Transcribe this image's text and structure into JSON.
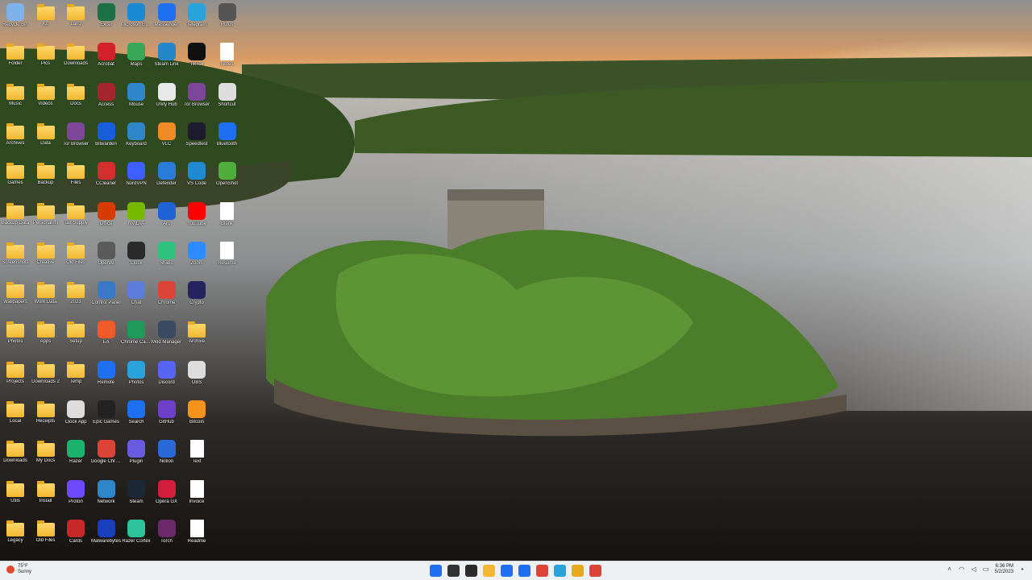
{
  "desktop": {
    "wallpaper": "lake-castle-island",
    "icons": [
      {
        "label": "Recycle Bin",
        "kind": "app",
        "icon": "recycle-bin-icon",
        "color": "#7fb2e8"
      },
      {
        "label": "Kit",
        "kind": "folder",
        "icon": "folder-icon",
        "color": "#f2b731"
      },
      {
        "label": "Lang",
        "kind": "folder",
        "icon": "folder-icon",
        "color": "#f2b731"
      },
      {
        "label": "Excel",
        "kind": "app",
        "icon": "excel-icon",
        "color": "#1d7044"
      },
      {
        "label": "Microsoft Edge",
        "kind": "app",
        "icon": "edge-icon",
        "color": "#1a8ad4"
      },
      {
        "label": "Messenger",
        "kind": "app",
        "icon": "messenger-icon",
        "color": "#1e6ff2"
      },
      {
        "label": "Telegram",
        "kind": "app",
        "icon": "telegram-icon",
        "color": "#2aa3dd"
      },
      {
        "label": "Rufus",
        "kind": "app",
        "icon": "usb-icon",
        "color": "#555555"
      },
      {
        "label": "Folder",
        "kind": "folder",
        "icon": "folder-icon",
        "color": "#f2b731"
      },
      {
        "label": "Pics",
        "kind": "folder",
        "icon": "folder-icon",
        "color": "#f2b731"
      },
      {
        "label": "Downloads",
        "kind": "folder",
        "icon": "folder-icon",
        "color": "#f2b731"
      },
      {
        "label": "Acrobat",
        "kind": "app",
        "icon": "pdf-icon",
        "color": "#d3202a"
      },
      {
        "label": "Maps",
        "kind": "app",
        "icon": "maps-icon",
        "color": "#3aa657"
      },
      {
        "label": "Steam Link",
        "kind": "app",
        "icon": "steam-link-icon",
        "color": "#2487c9"
      },
      {
        "label": "TikTok",
        "kind": "app",
        "icon": "tiktok-icon",
        "color": "#111111"
      },
      {
        "label": "Notes",
        "kind": "doc",
        "icon": "document-icon",
        "color": "#ffffff"
      },
      {
        "label": "Music",
        "kind": "folder",
        "icon": "folder-icon",
        "color": "#f2b731"
      },
      {
        "label": "Videos",
        "kind": "folder",
        "icon": "folder-icon",
        "color": "#f2b731"
      },
      {
        "label": "Docs",
        "kind": "folder",
        "icon": "folder-icon",
        "color": "#f2b731"
      },
      {
        "label": "Access",
        "kind": "app",
        "icon": "access-icon",
        "color": "#a4262c"
      },
      {
        "label": "Mouse",
        "kind": "app",
        "icon": "mouse-icon",
        "color": "#2f86c8"
      },
      {
        "label": "Unity Hub",
        "kind": "app",
        "icon": "unity-icon",
        "color": "#e8e8e8"
      },
      {
        "label": "Tor Browser",
        "kind": "app",
        "icon": "tor-icon",
        "color": "#7d4698"
      },
      {
        "label": "Shortcut",
        "kind": "app",
        "icon": "shortcut-icon",
        "color": "#dddddd"
      },
      {
        "label": "Archives",
        "kind": "folder",
        "icon": "folder-icon",
        "color": "#f2b731"
      },
      {
        "label": "Data",
        "kind": "folder",
        "icon": "folder-icon",
        "color": "#f2b731"
      },
      {
        "label": "Tor Browser",
        "kind": "app",
        "icon": "tor-icon",
        "color": "#7d4698"
      },
      {
        "label": "Bitwarden",
        "kind": "app",
        "icon": "bitwarden-icon",
        "color": "#175ddc"
      },
      {
        "label": "Keyboard",
        "kind": "app",
        "icon": "keyboard-icon",
        "color": "#2f86c8"
      },
      {
        "label": "VLC",
        "kind": "app",
        "icon": "vlc-icon",
        "color": "#f08a24"
      },
      {
        "label": "Speedtest",
        "kind": "app",
        "icon": "gauge-icon",
        "color": "#1c1c2e"
      },
      {
        "label": "Bluetooth",
        "kind": "app",
        "icon": "bluetooth-icon",
        "color": "#1e6ff2"
      },
      {
        "label": "Games",
        "kind": "folder",
        "icon": "folder-icon",
        "color": "#f2b731"
      },
      {
        "label": "Backup",
        "kind": "folder",
        "icon": "folder-icon",
        "color": "#f2b731"
      },
      {
        "label": "Files",
        "kind": "folder",
        "icon": "folder-icon",
        "color": "#f2b731"
      },
      {
        "label": "CCleaner",
        "kind": "app",
        "icon": "ccleaner-icon",
        "color": "#d32f2f"
      },
      {
        "label": "NordVPN",
        "kind": "app",
        "icon": "nordvpn-icon",
        "color": "#3e5fff"
      },
      {
        "label": "Defender",
        "kind": "app",
        "icon": "shield-icon",
        "color": "#2b7bd9"
      },
      {
        "label": "VS Code",
        "kind": "app",
        "icon": "vscode-icon",
        "color": "#1f8ad2"
      },
      {
        "label": "OpenShot",
        "kind": "app",
        "icon": "openshot-icon",
        "color": "#4fae3b"
      },
      {
        "label": "Backup Data",
        "kind": "folder",
        "icon": "folder-icon",
        "color": "#f2b731"
      },
      {
        "label": "Personal_fil",
        "kind": "folder",
        "icon": "folder-icon",
        "color": "#f2b731"
      },
      {
        "label": "Tax Supply",
        "kind": "folder",
        "icon": "folder-icon",
        "color": "#f2b731"
      },
      {
        "label": "Office",
        "kind": "app",
        "icon": "office-icon",
        "color": "#d83b01"
      },
      {
        "label": "NVIDIA",
        "kind": "app",
        "icon": "nvidia-icon",
        "color": "#76b900"
      },
      {
        "label": "Arc",
        "kind": "app",
        "icon": "arc-icon",
        "color": "#1f63d6"
      },
      {
        "label": "YouTube",
        "kind": "app",
        "icon": "youtube-icon",
        "color": "#ff0000"
      },
      {
        "label": "Blank",
        "kind": "doc",
        "icon": "document-icon",
        "color": "#ffffff"
      },
      {
        "label": "Screenshots",
        "kind": "folder",
        "icon": "folder-icon",
        "color": "#f2b731"
      },
      {
        "label": "Creative",
        "kind": "folder",
        "icon": "folder-icon",
        "color": "#f2b731"
      },
      {
        "label": "Old Files",
        "kind": "folder",
        "icon": "folder-icon",
        "color": "#f2b731"
      },
      {
        "label": "OpenAI",
        "kind": "app",
        "icon": "openai-icon",
        "color": "#5a5a5a"
      },
      {
        "label": "Clock",
        "kind": "app",
        "icon": "clock-icon",
        "color": "#2b2b2b"
      },
      {
        "label": "Shield",
        "kind": "app",
        "icon": "shield-icon",
        "color": "#2ec27e"
      },
      {
        "label": "Zoom",
        "kind": "app",
        "icon": "zoom-icon",
        "color": "#2d8cff"
      },
      {
        "label": "Resume",
        "kind": "doc",
        "icon": "pdf-doc-icon",
        "color": "#ffffff"
      },
      {
        "label": "Wallpapers",
        "kind": "folder",
        "icon": "folder-icon",
        "color": "#f2b731"
      },
      {
        "label": "Work Data",
        "kind": "folder",
        "icon": "folder-icon",
        "color": "#f2b731"
      },
      {
        "label": "2023",
        "kind": "folder",
        "icon": "folder-icon",
        "color": "#f2b731"
      },
      {
        "label": "Control Panel",
        "kind": "app",
        "icon": "control-panel-icon",
        "color": "#3b78c6"
      },
      {
        "label": "Chat",
        "kind": "app",
        "icon": "chat-icon",
        "color": "#5c7ddb"
      },
      {
        "label": "Chrome",
        "kind": "app",
        "icon": "chrome-icon",
        "color": "#db4437"
      },
      {
        "label": "Crypto",
        "kind": "app",
        "icon": "crypto-icon",
        "color": "#26225e"
      },
      {
        "label": "Photos",
        "kind": "folder",
        "icon": "folder-icon",
        "color": "#f2b731"
      },
      {
        "label": "Apps",
        "kind": "folder",
        "icon": "folder-icon",
        "color": "#f2b731"
      },
      {
        "label": "Setup",
        "kind": "folder",
        "icon": "folder-icon",
        "color": "#f2b731"
      },
      {
        "label": "EA",
        "kind": "app",
        "icon": "ea-icon",
        "color": "#f05a28"
      },
      {
        "label": "Chrome Canary",
        "kind": "app",
        "icon": "chrome-icon",
        "color": "#1e9b5a"
      },
      {
        "label": "Mod Manager",
        "kind": "app",
        "icon": "skull-icon",
        "color": "#3a4a60"
      },
      {
        "label": "Archive",
        "kind": "folder",
        "icon": "folder-icon",
        "color": "#f2b731"
      },
      {
        "label": "Projects",
        "kind": "folder",
        "icon": "folder-icon",
        "color": "#f2b731"
      },
      {
        "label": "Downloads 2",
        "kind": "folder",
        "icon": "folder-icon",
        "color": "#f2b731"
      },
      {
        "label": "Temp",
        "kind": "folder",
        "icon": "folder-icon",
        "color": "#f2b731"
      },
      {
        "label": "Remote",
        "kind": "app",
        "icon": "remote-icon",
        "color": "#1e6ff2"
      },
      {
        "label": "Photos",
        "kind": "app",
        "icon": "photos-icon",
        "color": "#2aa3dd"
      },
      {
        "label": "Discord",
        "kind": "app",
        "icon": "discord-icon",
        "color": "#5865f2"
      },
      {
        "label": "OBS",
        "kind": "app",
        "icon": "obs-icon",
        "color": "#dddddd"
      },
      {
        "label": "Local",
        "kind": "folder",
        "icon": "folder-icon",
        "color": "#f2b731"
      },
      {
        "label": "Receipts",
        "kind": "folder",
        "icon": "folder-icon",
        "color": "#f2b731"
      },
      {
        "label": "Clock App",
        "kind": "app",
        "icon": "alarm-icon",
        "color": "#dddddd"
      },
      {
        "label": "Epic Games",
        "kind": "app",
        "icon": "epic-icon",
        "color": "#222222"
      },
      {
        "label": "Search",
        "kind": "app",
        "icon": "search-icon",
        "color": "#1e6ff2"
      },
      {
        "label": "GitHub",
        "kind": "app",
        "icon": "github-icon",
        "color": "#6e40c9"
      },
      {
        "label": "Bitcoin",
        "kind": "app",
        "icon": "bitcoin-icon",
        "color": "#f7931a"
      },
      {
        "label": "Downloads",
        "kind": "folder",
        "icon": "folder-icon",
        "color": "#f2b731"
      },
      {
        "label": "My Docs",
        "kind": "folder",
        "icon": "folder-icon",
        "color": "#f2b731"
      },
      {
        "label": "Razer",
        "kind": "app",
        "icon": "razer-icon",
        "color": "#1bb36b"
      },
      {
        "label": "Google Chrome",
        "kind": "app",
        "icon": "chrome-icon",
        "color": "#db4437"
      },
      {
        "label": "Plugin",
        "kind": "app",
        "icon": "plugin-icon",
        "color": "#6a5ae0"
      },
      {
        "label": "Notion",
        "kind": "app",
        "icon": "notion-icon",
        "color": "#2a6ad8"
      },
      {
        "label": "Text",
        "kind": "doc",
        "icon": "document-icon",
        "color": "#ffffff"
      },
      {
        "label": "Utils",
        "kind": "folder",
        "icon": "folder-icon",
        "color": "#f2b731"
      },
      {
        "label": "Install",
        "kind": "folder",
        "icon": "folder-icon",
        "color": "#f2b731"
      },
      {
        "label": "Proton",
        "kind": "app",
        "icon": "proton-icon",
        "color": "#6d4aff"
      },
      {
        "label": "Network",
        "kind": "app",
        "icon": "network-icon",
        "color": "#2f86c8"
      },
      {
        "label": "Steam",
        "kind": "app",
        "icon": "steam-icon",
        "color": "#1b2838"
      },
      {
        "label": "Opera GX",
        "kind": "app",
        "icon": "opera-icon",
        "color": "#d21e3c"
      },
      {
        "label": "Invoice",
        "kind": "doc",
        "icon": "pdf-doc-icon",
        "color": "#ffffff"
      },
      {
        "label": "Legacy",
        "kind": "folder",
        "icon": "folder-icon",
        "color": "#f2b731"
      },
      {
        "label": "Old Files",
        "kind": "folder",
        "icon": "folder-icon",
        "color": "#f2b731"
      },
      {
        "label": "Cards",
        "kind": "app",
        "icon": "cards-icon",
        "color": "#c62828"
      },
      {
        "label": "Malwarebytes",
        "kind": "app",
        "icon": "malwarebytes-icon",
        "color": "#1a3fbe"
      },
      {
        "label": "Razer Cortex",
        "kind": "app",
        "icon": "cortex-icon",
        "color": "#2ec29b"
      },
      {
        "label": "Torch",
        "kind": "app",
        "icon": "torch-icon",
        "color": "#6a2a6a"
      },
      {
        "label": "Readme",
        "kind": "doc",
        "icon": "document-icon",
        "color": "#ffffff"
      }
    ]
  },
  "taskbar": {
    "weather": {
      "line1": "75°F",
      "line2": "Sunny"
    },
    "pinned": [
      {
        "name": "start-button",
        "color": "#1e6ff2"
      },
      {
        "name": "task-view-button",
        "color": "#333333"
      },
      {
        "name": "terminal-button",
        "color": "#2b2b2b"
      },
      {
        "name": "file-explorer-button",
        "color": "#f2b731"
      },
      {
        "name": "store-button",
        "color": "#1e6ff2"
      },
      {
        "name": "messenger-button",
        "color": "#1e6ff2"
      },
      {
        "name": "chrome-button",
        "color": "#db4437"
      },
      {
        "name": "notepad-button",
        "color": "#2aa3dd"
      },
      {
        "name": "chrome-canary-button",
        "color": "#e8a91f"
      },
      {
        "name": "chrome-dev-button",
        "color": "#db4437"
      }
    ],
    "clock": {
      "time": "6:36 PM",
      "date": "5/2/2023"
    }
  }
}
